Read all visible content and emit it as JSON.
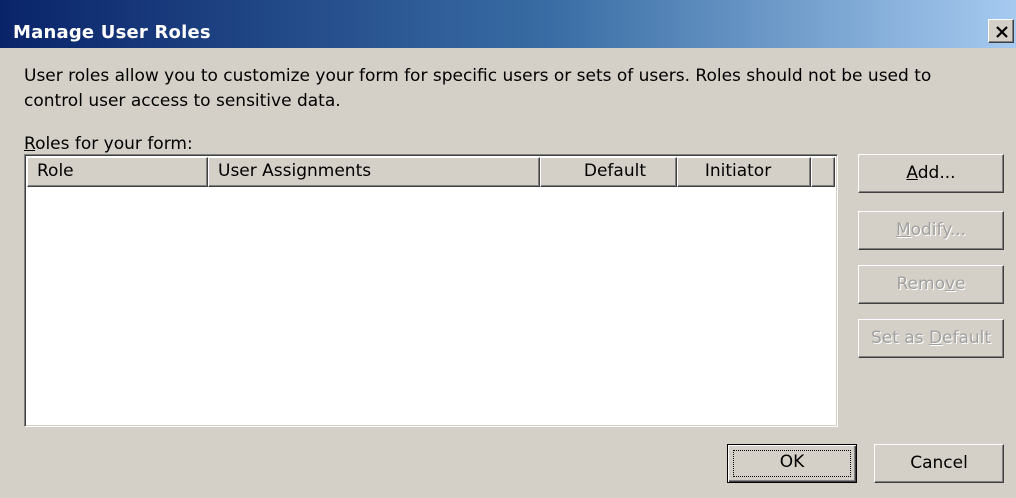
{
  "dialog": {
    "title": "Manage User Roles",
    "close_glyph": "✕",
    "description": "User roles allow you to customize your form for specific users or sets of users. Roles should not be used to control user access to sensitive data.",
    "roles_label_prefix": "",
    "roles_label_accel": "R",
    "roles_label_rest": "oles for your form:"
  },
  "table": {
    "columns": [
      "Role",
      "User Assignments",
      "Default",
      "Initiator"
    ],
    "rows": []
  },
  "buttons": {
    "add": {
      "pre": "",
      "accel": "A",
      "post": "dd...",
      "enabled": true
    },
    "modify": {
      "pre": "",
      "accel": "M",
      "post": "odify...",
      "enabled": false
    },
    "remove": {
      "pre": "Remo",
      "accel": "v",
      "post": "e",
      "enabled": false
    },
    "set_default": {
      "pre": "Set as ",
      "accel": "D",
      "post": "efault",
      "enabled": false
    },
    "ok": {
      "label": "OK"
    },
    "cancel": {
      "label": "Cancel"
    }
  }
}
